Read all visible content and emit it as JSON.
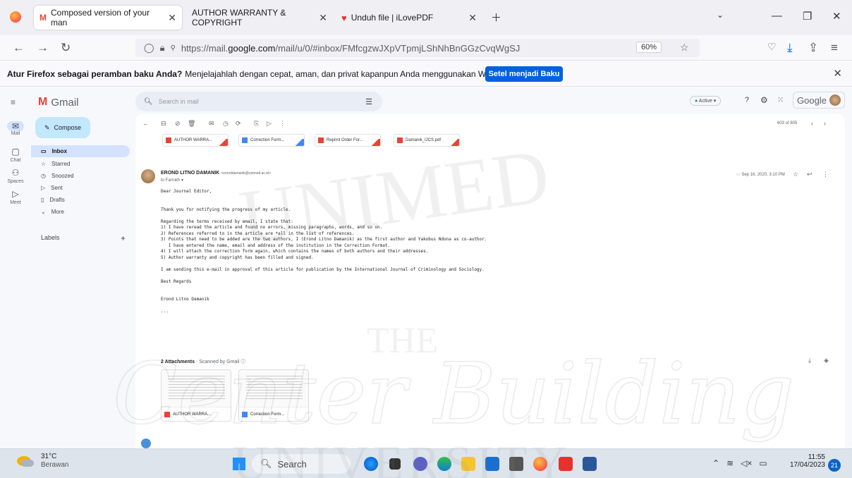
{
  "browser": {
    "tabs": [
      {
        "label": "Composed version of your man",
        "active": true
      },
      {
        "label": "AUTHOR WARRANTY & COPYRIGHT",
        "active": false
      },
      {
        "label": "Unduh file | iLovePDF",
        "active": false
      }
    ],
    "url_prefix": "https://mail.",
    "url_host": "google.com",
    "url_path": "/mail/u/0/#inbox/FMfcgzwJXpVTpmjLShNhBnGGzCvqWgSJ",
    "zoom": "60%"
  },
  "notification": {
    "bold": "Atur Firefox sebagai peramban baku Anda?",
    "text": "Menjelajahlah dengan cepat, aman, dan privat kapanpun Anda menggunakan Web.",
    "button": "Setel menjadi Baku"
  },
  "gmail": {
    "logo": "Gmail",
    "search_placeholder": "Search in mail",
    "status": "Active",
    "brand": "Google",
    "compose": "Compose",
    "rail": [
      {
        "icon": "mail-icon",
        "label": "Mail"
      },
      {
        "icon": "chat-icon",
        "label": "Chat"
      },
      {
        "icon": "spaces-icon",
        "label": "Spaces"
      },
      {
        "icon": "meet-icon",
        "label": "Meet"
      }
    ],
    "nav": [
      {
        "label": "Inbox",
        "icon": "▭",
        "selected": true
      },
      {
        "label": "Starred",
        "icon": "☆",
        "selected": false
      },
      {
        "label": "Snoozed",
        "icon": "◷",
        "selected": false
      },
      {
        "label": "Sent",
        "icon": "▷",
        "selected": false
      },
      {
        "label": "Drafts",
        "icon": "▯",
        "selected": false
      },
      {
        "label": "More",
        "icon": "⌄",
        "selected": false
      }
    ],
    "labels_heading": "Labels",
    "pager": "603 of 805",
    "top_attachments": [
      "AUTHOR WARRA...",
      "Correction Form...",
      "Reprint Order For...",
      "Damanik_IJCS.pdf"
    ],
    "sender_name": "EROND LITNO DAMANIK",
    "sender_email": "<eronddamanik@unimed.ac.id>",
    "to": "to Farrukh",
    "date": "Sep 16, 2020, 3:10 PM",
    "body": [
      "Dear Journal Editor,",
      "",
      "",
      "Thank you for notifying the progress of my article.",
      "",
      "Regarding the terms received by email, I state that:",
      "1) I have reread the article and found no errors, missing paragraphs, words, and so on.",
      "2) References referred to in the article are *all in the list of references.",
      "3) Points that need to be added are the two authors, I (Erond Litno Damanik) as the first author and Yakobus Ndona as co-author.",
      "   I have entered the name, email and address of the institution in the Correction Format.",
      "4) I will attach the correction form again, which contains the names of both authors and their addresses.",
      "5) Author warranty and copyright has been filled and signed.",
      "",
      "I am sending this e-mail in approval of this article for publication by the International Journal of Criminology and Sociology.",
      "",
      "Best Regards",
      "",
      "",
      "Erond Litno Damanik",
      "",
      "..."
    ],
    "attachments_heading": "2 Attachments",
    "attachments_scanned": "· Scanned by Gmail ⓘ",
    "attachments": [
      "AUTHOR WARRA...",
      "Correction Form..."
    ]
  },
  "taskbar": {
    "temp": "31°C",
    "weather": "Berawan",
    "search": "Search",
    "time": "11:55",
    "date": "17/04/2023",
    "notif_count": "21"
  },
  "watermark": {
    "line1": "UNIMED",
    "line2": "THE",
    "line3": "Center Building",
    "line4": "UNIVERSITY"
  }
}
